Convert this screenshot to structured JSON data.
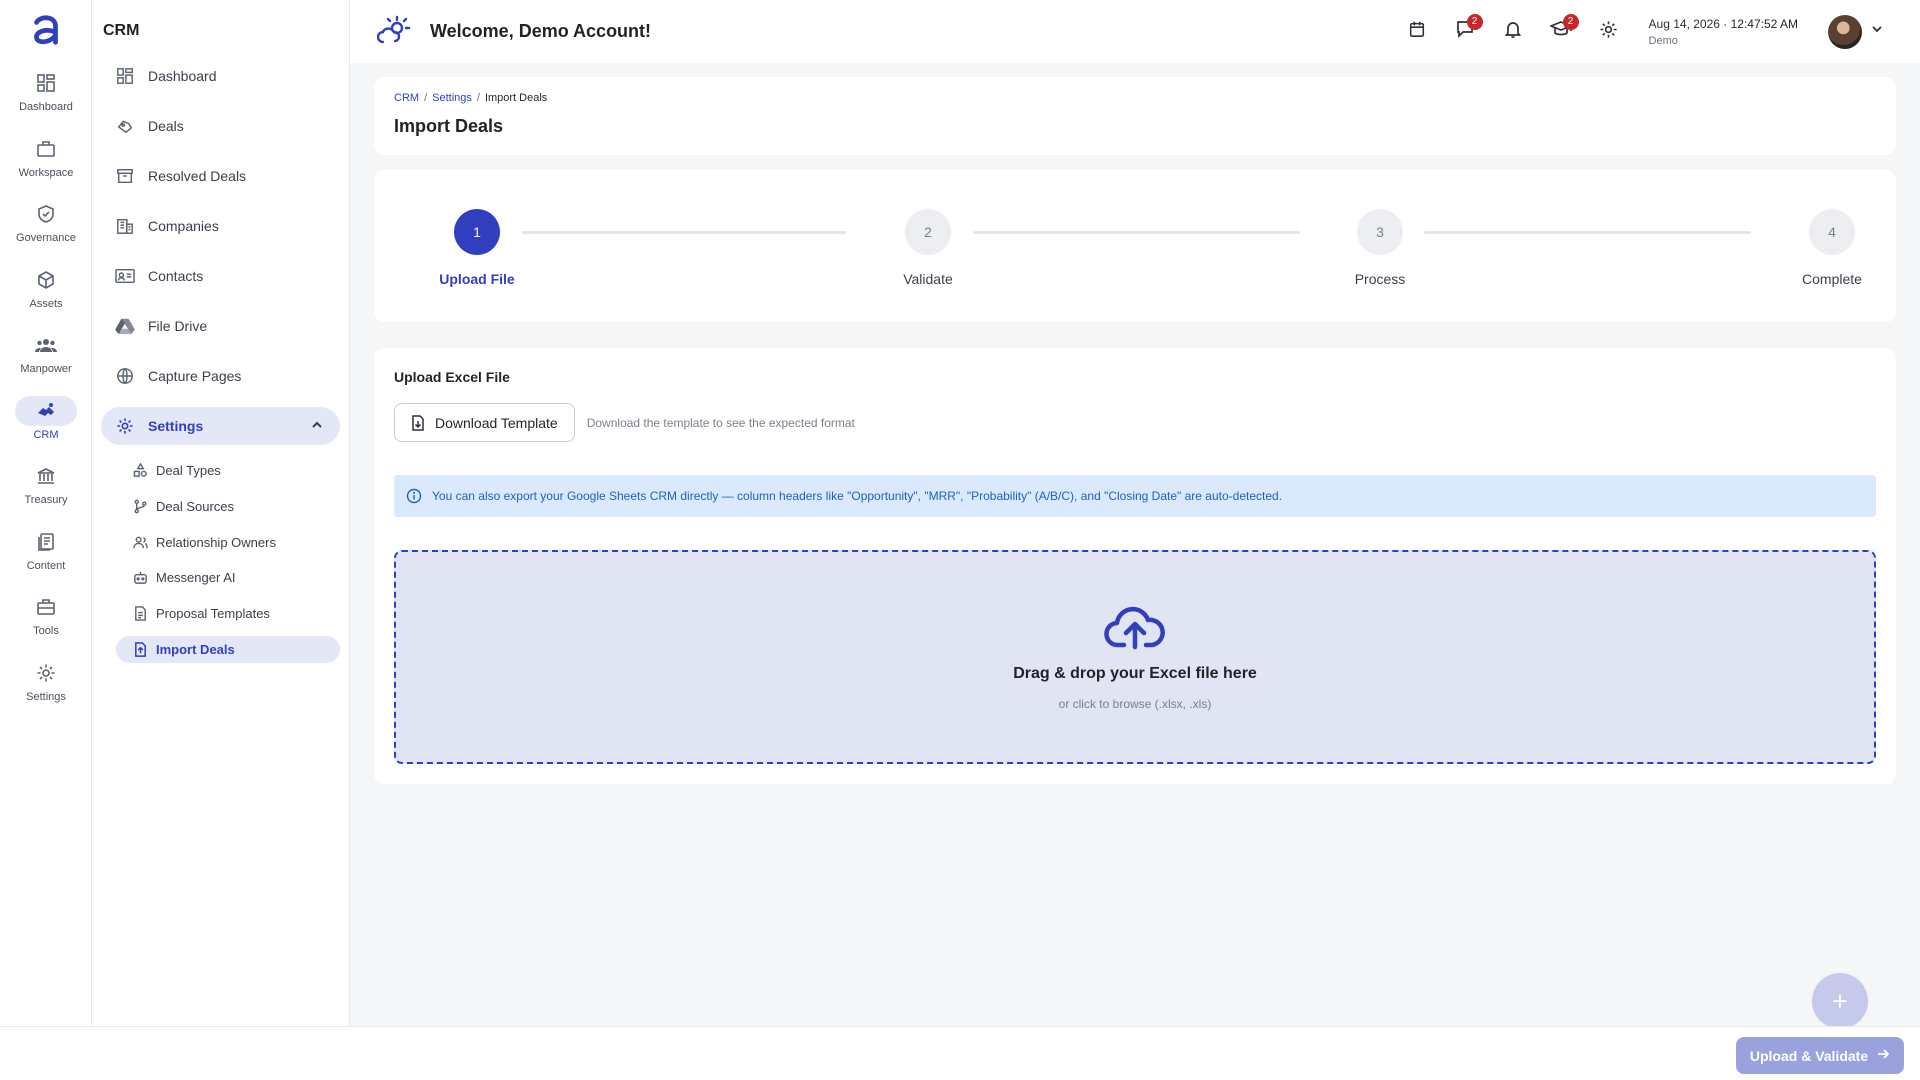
{
  "rail": {
    "items": [
      {
        "label": "Dashboard",
        "icon": "dashboard-icon"
      },
      {
        "label": "Workspace",
        "icon": "briefcase-icon"
      },
      {
        "label": "Governance",
        "icon": "shield-check-icon"
      },
      {
        "label": "Assets",
        "icon": "cube-icon"
      },
      {
        "label": "Manpower",
        "icon": "people-icon"
      },
      {
        "label": "CRM",
        "icon": "handshake-icon"
      },
      {
        "label": "Treasury",
        "icon": "bank-icon"
      },
      {
        "label": "Content",
        "icon": "documents-icon"
      },
      {
        "label": "Tools",
        "icon": "toolbox-icon"
      },
      {
        "label": "Settings",
        "icon": "gear-icon"
      }
    ]
  },
  "sidebar": {
    "title": "CRM",
    "items": [
      {
        "label": "Dashboard",
        "icon": "dashboard-icon"
      },
      {
        "label": "Deals",
        "icon": "deal-icon"
      },
      {
        "label": "Resolved Deals",
        "icon": "archive-icon"
      },
      {
        "label": "Companies",
        "icon": "building-icon"
      },
      {
        "label": "Contacts",
        "icon": "contact-card-icon"
      },
      {
        "label": "File Drive",
        "icon": "drive-icon"
      },
      {
        "label": "Capture Pages",
        "icon": "globe-icon"
      },
      {
        "label": "Settings",
        "icon": "gear-icon"
      }
    ],
    "settings_sub": [
      {
        "label": "Deal Types",
        "icon": "shapes-icon"
      },
      {
        "label": "Deal Sources",
        "icon": "branch-icon"
      },
      {
        "label": "Relationship Owners",
        "icon": "people-icon"
      },
      {
        "label": "Messenger AI",
        "icon": "robot-icon"
      },
      {
        "label": "Proposal Templates",
        "icon": "document-icon"
      },
      {
        "label": "Import Deals",
        "icon": "file-import-icon"
      }
    ]
  },
  "header": {
    "welcome": "Welcome, Demo Account!",
    "chat_badge": "2",
    "learn_badge": "2",
    "date": "Aug 14, 2026",
    "time": "12:47:52 AM",
    "user": "Demo"
  },
  "page": {
    "breadcrumb": [
      "CRM",
      "Settings",
      "Import Deals"
    ],
    "title": "Import Deals"
  },
  "stepper": {
    "steps": [
      {
        "number": "1",
        "label": "Upload File"
      },
      {
        "number": "2",
        "label": "Validate"
      },
      {
        "number": "3",
        "label": "Process"
      },
      {
        "number": "4",
        "label": "Complete"
      }
    ],
    "active_step": 1
  },
  "upload": {
    "section_title": "Upload Excel File",
    "download_label": "Download Template",
    "download_hint": "Download the template to see the expected format",
    "info_text": "You can also export your Google Sheets CRM directly — column headers like \"Opportunity\", \"MRR\", \"Probability\" (A/B/C), and \"Closing Date\" are auto-detected.",
    "drop_title": "Drag & drop your Excel file here",
    "drop_sub": "or click to browse (.xlsx, .xls)"
  },
  "footer": {
    "upload_validate": "Upload & Validate",
    "fab": "+"
  },
  "colors": {
    "accent": "#2f3fbf",
    "accent_soft": "#e4e7f5",
    "info_bg": "#dbe9fd",
    "badge": "#c62828"
  }
}
